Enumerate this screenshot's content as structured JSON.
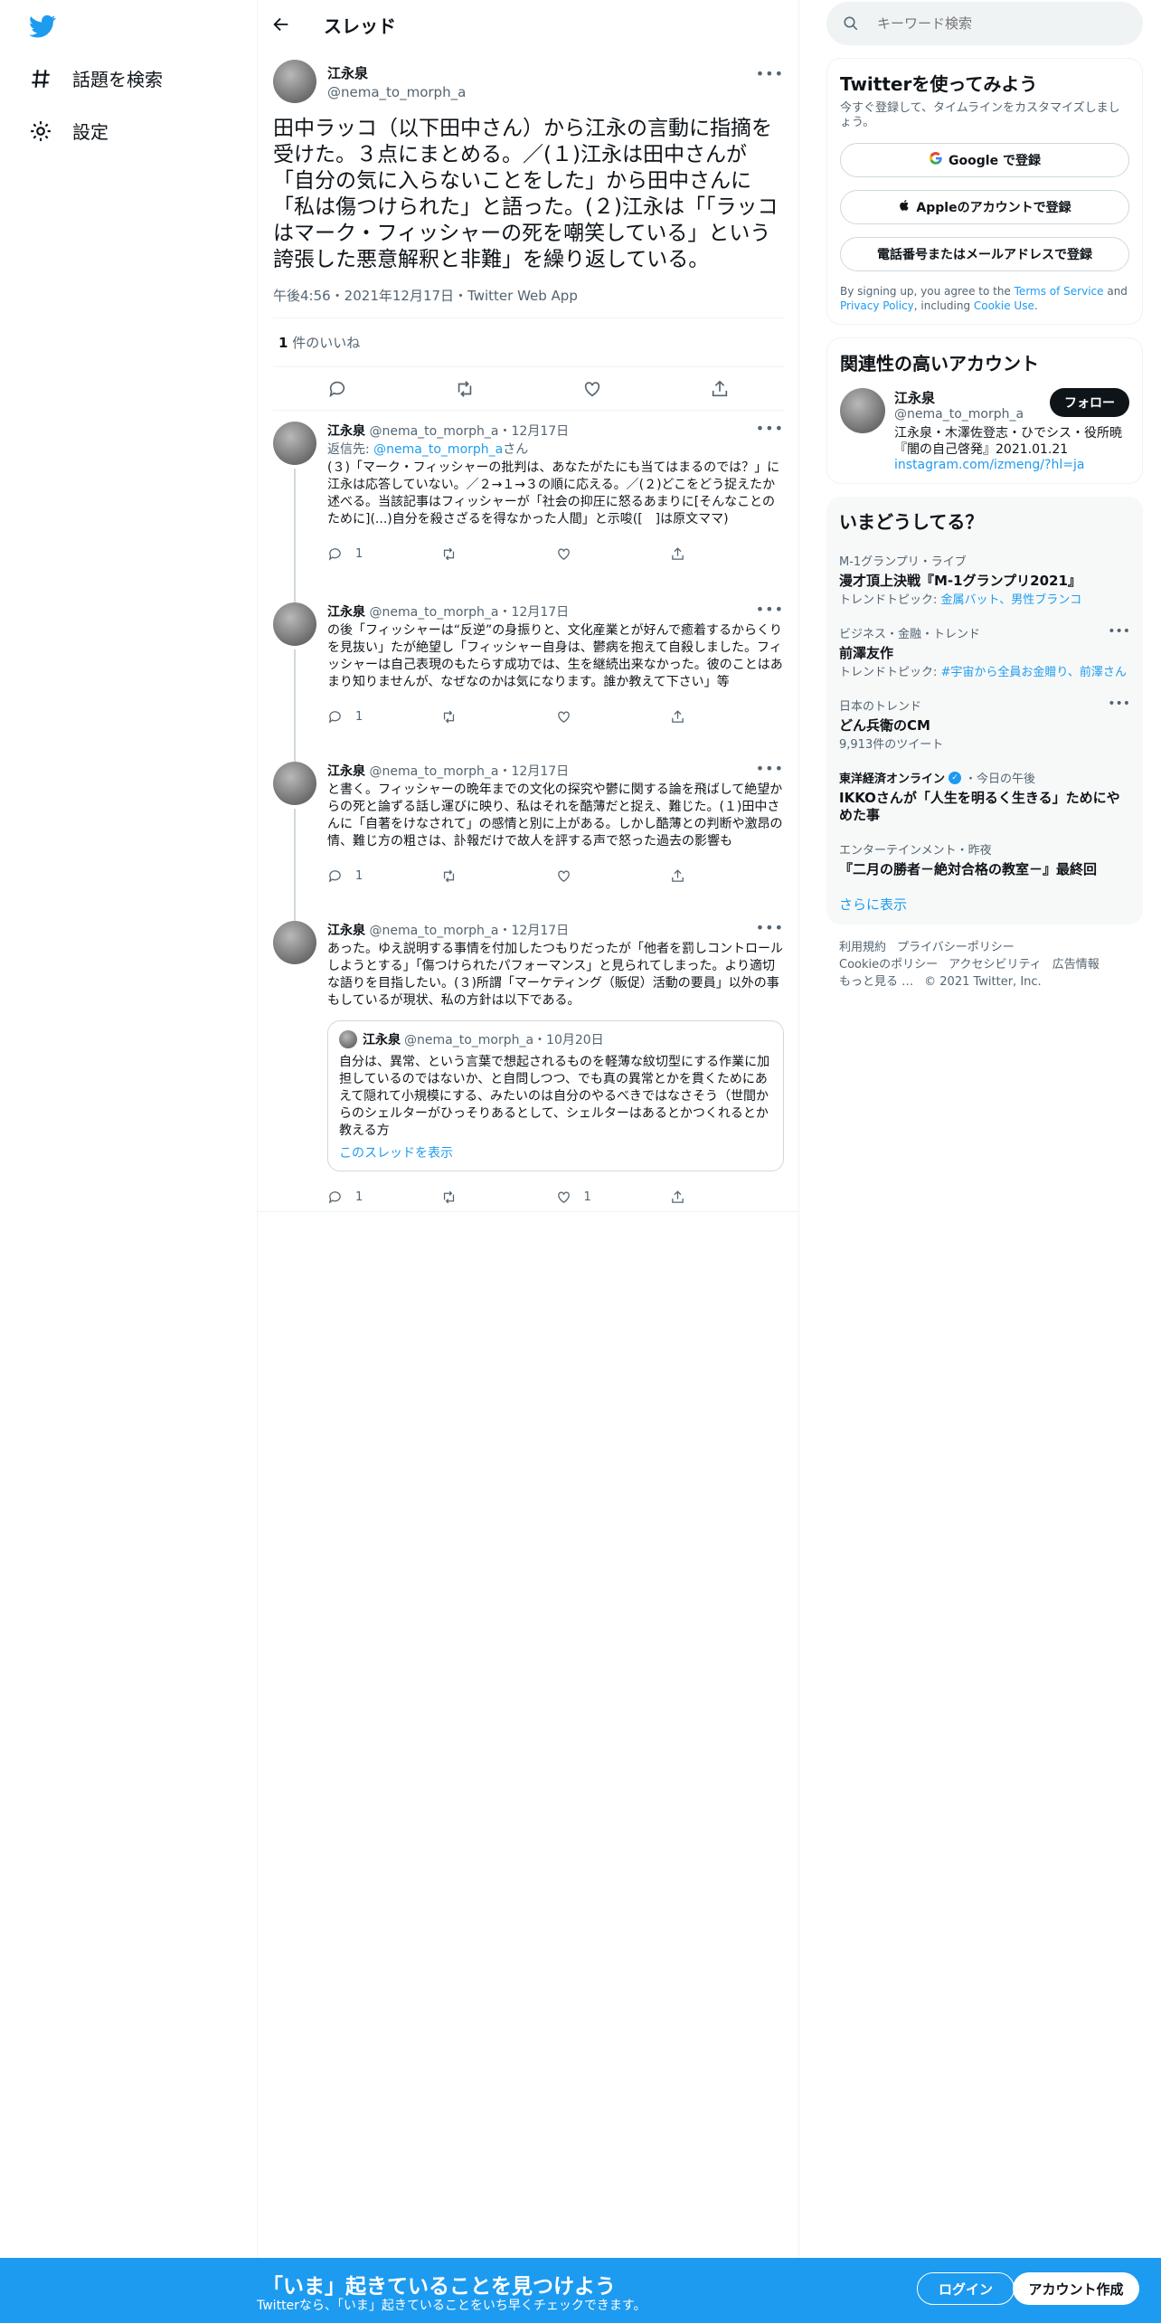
{
  "nav": {
    "explore_label": "話題を検索",
    "settings_label": "設定"
  },
  "header": {
    "title": "スレッド"
  },
  "main_tweet": {
    "name": "江永泉",
    "handle": "@nema_to_morph_a",
    "text": "田中ラッコ（以下田中さん）から江永の言動に指摘を受けた。３点にまとめる。／(１)江永は田中さんが「自分の気に入らないことをした」から田中さんに「私は傷つけられた」と語った。(２)江永は「「ラッコはマーク・フィッシャーの死を嘲笑している」という誇張した悪意解釈と非難」を繰り返している。",
    "meta": "午後4:56・2021年12月17日・Twitter Web App",
    "likes_count": "1",
    "likes_label": "件のいいね"
  },
  "replies": [
    {
      "name": "江永泉",
      "meta": "@nema_to_morph_a・12月17日",
      "reply_to_prefix": "返信先: ",
      "reply_to_handle": "@nema_to_morph_a",
      "reply_to_suffix": "さん",
      "text": "(３)「マーク・フィッシャーの批判は、あなたがたにも当てはまるのでは？」に江永は応答していない。／２→１→３の順に応える。／(２)どこをどう捉えたか述べる。当該記事はフィッシャーが「社会の抑圧に怒るあまりに[そんなことのために](...)自分を殺さざるを得なかった人間」と示唆([　]は原文ママ)",
      "replies": "1",
      "retweets": "",
      "likes": ""
    },
    {
      "name": "江永泉",
      "meta": "@nema_to_morph_a・12月17日",
      "text": "の後「フィッシャーは“反逆”の身振りと、文化産業とが好んで癒着するからくりを見抜い」たが絶望し「フィッシャー自身は、鬱病を抱えて自殺しました。フィッシャーは自己表現のもたらす成功では、生を継続出来なかった。彼のことはあまり知りませんが、なぜなのかは気になります。誰か教えて下さい」等",
      "replies": "1",
      "retweets": "",
      "likes": ""
    },
    {
      "name": "江永泉",
      "meta": "@nema_to_morph_a・12月17日",
      "text": "と書く。フィッシャーの晩年までの文化の探究や鬱に関する論を飛ばして絶望からの死と論ずる話し運びに映り、私はそれを酷薄だと捉え、難じた。(１)田中さんに「自著をけなされて」の感情と別に上がある。しかし酷薄との判断や激昂の情、難じ方の粗さは、訃報だけで故人を評する声で怒った過去の影響も",
      "replies": "1",
      "retweets": "",
      "likes": ""
    },
    {
      "name": "江永泉",
      "meta": "@nema_to_morph_a・12月17日",
      "text": "あった。ゆえ説明する事情を付加したつもりだったが「他者を罰しコントロールしようとする」「傷つけられたパフォーマンス」と見られてしまった。より適切な語りを目指したい。(３)所謂「マーケティング（販促）活動の要員」以外の事もしているが現状、私の方針は以下である。",
      "replies": "1",
      "retweets": "",
      "likes": "1",
      "quote": {
        "name": "江永泉",
        "meta": "@nema_to_morph_a・10月20日",
        "text": "自分は、異常、という言葉で想起されるものを軽薄な紋切型にする作業に加担しているのではないか、と自問しつつ、でも真の異常とかを貫くためにあえて隠れて小規模にする、みたいのは自分のやるべきではなさそう（世間からのシェルターがひっそりあるとして、シェルターはあるとかつくれるとか教える方",
        "link": "このスレッドを表示"
      }
    }
  ],
  "search": {
    "placeholder": "キーワード検索"
  },
  "signup_card": {
    "title": "Twitterを使ってみよう",
    "subtitle": "今すぐ登録して、タイムラインをカスタマイズしましょう。",
    "google": "Google で登録",
    "apple": "Appleのアカウントで登録",
    "phone": "電話番号またはメールアドレスで登録",
    "terms_prefix": "By signing up, you agree to the ",
    "terms_link": "Terms of Service",
    "terms_and": " and ",
    "privacy_link": "Privacy Policy",
    "terms_including": ", including ",
    "cookie_link": "Cookie Use",
    "terms_end": "."
  },
  "related": {
    "title": "関連性の高いアカウント",
    "name": "江永泉",
    "handle": "@nema_to_morph_a",
    "bio": "江永泉・木澤佐登志・ひでシス・役所暁『闇の自己啓発』2021.01.21",
    "link": "instagram.com/izmeng/?hl=ja",
    "follow": "フォロー"
  },
  "trends": {
    "title": "いまどうしてる？",
    "items": [
      {
        "category": "M-1グランプリ・ライブ",
        "name": "漫才頂上決戦『M-1グランプリ2021』",
        "info_prefix": "トレンドトピック: ",
        "info_link": "金属バット、男性ブランコ"
      },
      {
        "category": "ビジネス・金融・トレンド",
        "name": "前澤友作",
        "info_prefix": "トレンドトピック: ",
        "info_link": "#宇宙から全員お金贈り、前澤さん"
      },
      {
        "category": "日本のトレンド",
        "name": "どん兵衛のCM",
        "info_plain": "9,913件のツイート"
      },
      {
        "source": "東洋経済オンライン",
        "source_time": "・今日の午後",
        "name": "IKKOさんが「人生を明るく生きる」ためにやめた事"
      },
      {
        "category": "エンターテインメント・昨夜",
        "name": "『二月の勝者－絶対合格の教室－』最終回"
      }
    ],
    "show_more": "さらに表示"
  },
  "footer": {
    "links1": [
      "利用規約",
      "プライバシーポリシー"
    ],
    "links2": [
      "Cookieのポリシー",
      "アクセシビリティ",
      "広告情報"
    ],
    "more": "もっと見る …",
    "copyright": "© 2021 Twitter, Inc."
  },
  "bottom_bar": {
    "title": "「いま」起きていることを見つけよう",
    "subtitle": "Twitterなら、「いま」起きていることをいち早くチェックできます。",
    "login": "ログイン",
    "signup": "アカウント作成"
  },
  "colors": {
    "accent": "#1d9bf0",
    "text": "#0f1419",
    "muted": "#536471"
  }
}
